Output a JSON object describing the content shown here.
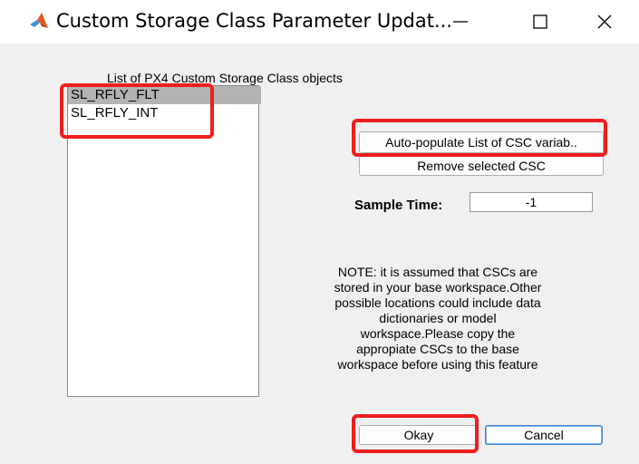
{
  "window": {
    "title": "Custom Storage Class Parameter Updat...",
    "icon": "matlab-icon",
    "controls": {
      "minimize": "—",
      "maximize": "☐",
      "close": "✕"
    }
  },
  "list": {
    "caption": "List of PX4 Custom Storage Class objects",
    "items": [
      "SL_RFLY_FLT",
      "SL_RFLY_INT"
    ],
    "selected_index": 0
  },
  "buttons": {
    "auto_populate": "Auto-populate List of CSC variab..",
    "remove": "Remove selected CSC",
    "okay": "Okay",
    "cancel": "Cancel"
  },
  "sample_time": {
    "label": "Sample Time:",
    "value": "-1"
  },
  "note": {
    "lines": [
      "NOTE: it is assumed that CSCs are",
      "stored in your base workspace.Other",
      "possible locations could include data",
      "dictionaries or model",
      "workspace.Please copy the",
      "appropiate CSCs to the base",
      "workspace before using this feature"
    ]
  },
  "colors": {
    "highlight": "#f01d1d",
    "selection": "#b3b3b3",
    "focus_border": "#3c82d4"
  }
}
